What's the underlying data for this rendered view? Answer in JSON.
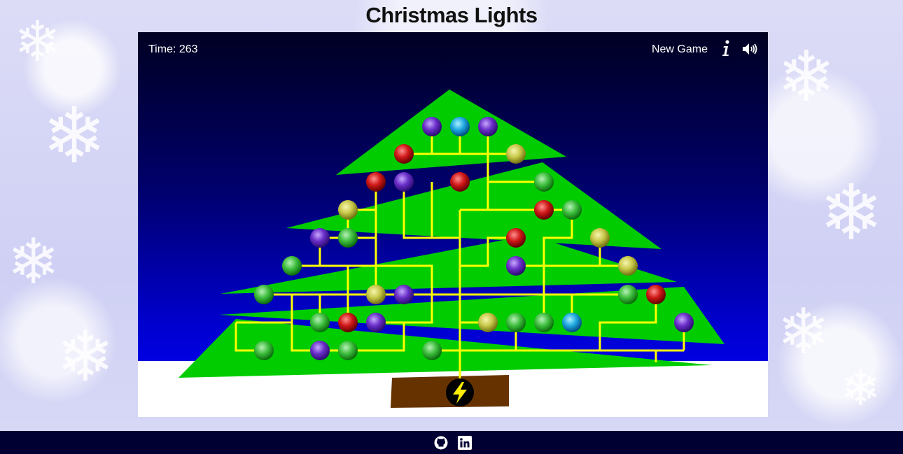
{
  "header": {
    "title": "Christmas Lights"
  },
  "hud": {
    "timer_label": "Time: 263",
    "new_game_label": "New Game",
    "info_icon": "info-icon",
    "sound_icon": "speaker-icon"
  },
  "footer": {
    "icons": [
      "github-icon",
      "linkedin-icon"
    ]
  },
  "colors": {
    "tree": "#00cc00",
    "wire": "#ffff00",
    "trunk": "#663300",
    "bulb_purple": "#6a2fc8",
    "bulb_cyan": "#1fa8e0",
    "bulb_red": "#d01818",
    "bulb_yellow": "#c8c84a",
    "bulb_green": "#3fbf3f"
  },
  "power_source_icon": "lightning-bolt-icon"
}
